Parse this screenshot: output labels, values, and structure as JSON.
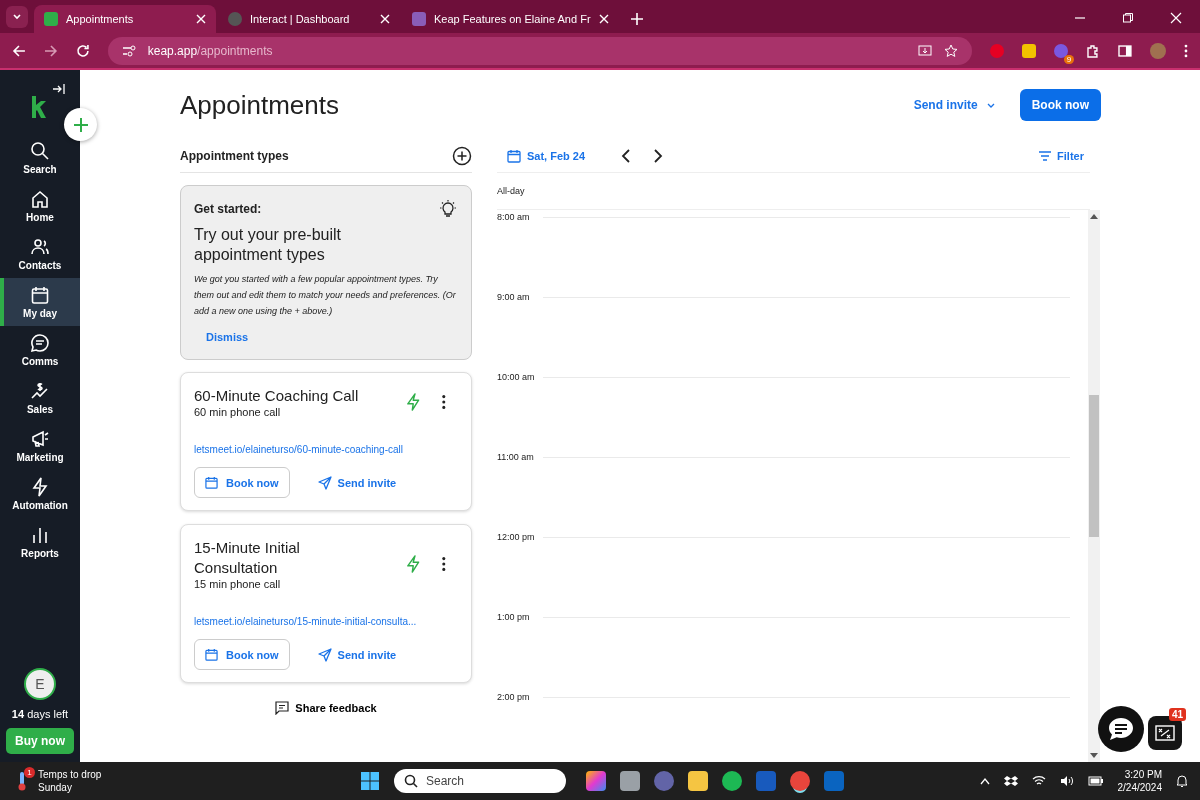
{
  "browser": {
    "tabs": [
      {
        "title": "Appointments",
        "selected": true
      },
      {
        "title": "Interact | Dashboard",
        "selected": false
      },
      {
        "title": "Keap Features on Elaine And Fr",
        "selected": false
      }
    ],
    "url": {
      "host": "keap.app",
      "path": "/appointments"
    },
    "extension_badge": "9"
  },
  "sidebar": {
    "items": [
      {
        "label": "Search",
        "selected": false
      },
      {
        "label": "Home",
        "selected": false
      },
      {
        "label": "Contacts",
        "selected": false
      },
      {
        "label": "My day",
        "selected": true
      },
      {
        "label": "Comms",
        "selected": false
      },
      {
        "label": "Sales",
        "selected": false
      },
      {
        "label": "Marketing",
        "selected": false
      },
      {
        "label": "Automation",
        "selected": false
      },
      {
        "label": "Reports",
        "selected": false
      }
    ],
    "avatar": "E",
    "trial": "**14** days left",
    "buy": "Buy now"
  },
  "page": {
    "title": "Appointments",
    "send_invite": "Send invite",
    "book_now": "Book now"
  },
  "appointment_types": {
    "heading": "Appointment types",
    "get_started": {
      "label": "Get started:",
      "heading": "Try out your pre-built appointment types",
      "body": "We got you started with a few popular appointment types. Try them out and edit them to match your needs and preferences. (Or add a new one using the + above.)",
      "dismiss": "Dismiss"
    },
    "items": [
      {
        "name": "60-Minute Coaching Call",
        "subtitle": "60 min phone call",
        "link": "letsmeet.io/elaineturso/60-minute-coaching-call",
        "book": "Book now",
        "send": "Send invite"
      },
      {
        "name": "15-Minute Initial Consultation",
        "subtitle": "15 min phone call",
        "link": "letsmeet.io/elaineturso/15-minute-initial-consulta...",
        "book": "Book now",
        "send": "Send invite"
      }
    ],
    "share_feedback": "Share feedback"
  },
  "calendar": {
    "date": "Sat, Feb 24",
    "filter": "Filter",
    "all_day": "All-day",
    "times": [
      "8:00 am",
      "9:00 am",
      "10:00 am",
      "11:00 am",
      "12:00 pm",
      "1:00 pm",
      "2:00 pm"
    ]
  },
  "chat_badge": "41",
  "taskbar": {
    "weather": {
      "title": "Temps to drop",
      "subtitle": "Sunday",
      "badge": "1"
    },
    "search": {
      "placeholder": "Search"
    },
    "time": "3:20 PM",
    "date": "2/24/2024"
  }
}
